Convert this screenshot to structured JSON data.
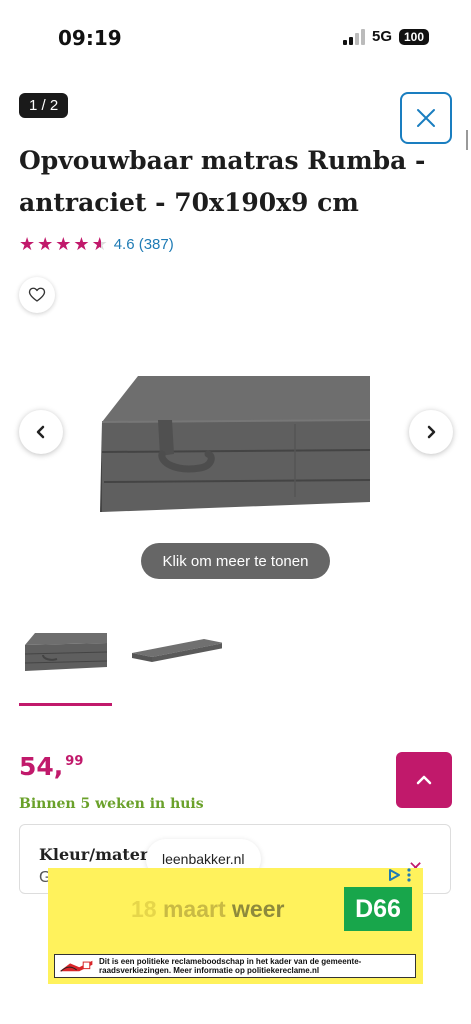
{
  "status_bar": {
    "time": "09:19",
    "network": "5G",
    "battery": "100"
  },
  "gallery": {
    "counter": "1 / 2",
    "show_more": "Klik om meer te tonen"
  },
  "product": {
    "title": "Opvouwbaar matras Rumba - antraciet - 70x190x9 cm",
    "rating_value": 4.6,
    "rating_label": "4.6 (387)",
    "price_whole": "54,",
    "price_cents": "99",
    "delivery": "Binnen 5 weken in huis",
    "options_heading": "Kleur/materiaal",
    "options_value": "G"
  },
  "url_chip": "leenbakker.nl",
  "ad": {
    "headline_1": "18",
    "headline_2": "maart",
    "headline_3": "weer",
    "logo": "D66",
    "disclaimer": "Dit is een politieke reclameboodschap in het kader van de gemeente-raadsverkiezingen. Meer informatie op politiekereclame.nl"
  },
  "colors": {
    "accent": "#c1196b",
    "link": "#1e7bb5",
    "delivery": "#6aa12a",
    "ad_bg": "#fff25c",
    "ad_logo": "#18a64b"
  }
}
